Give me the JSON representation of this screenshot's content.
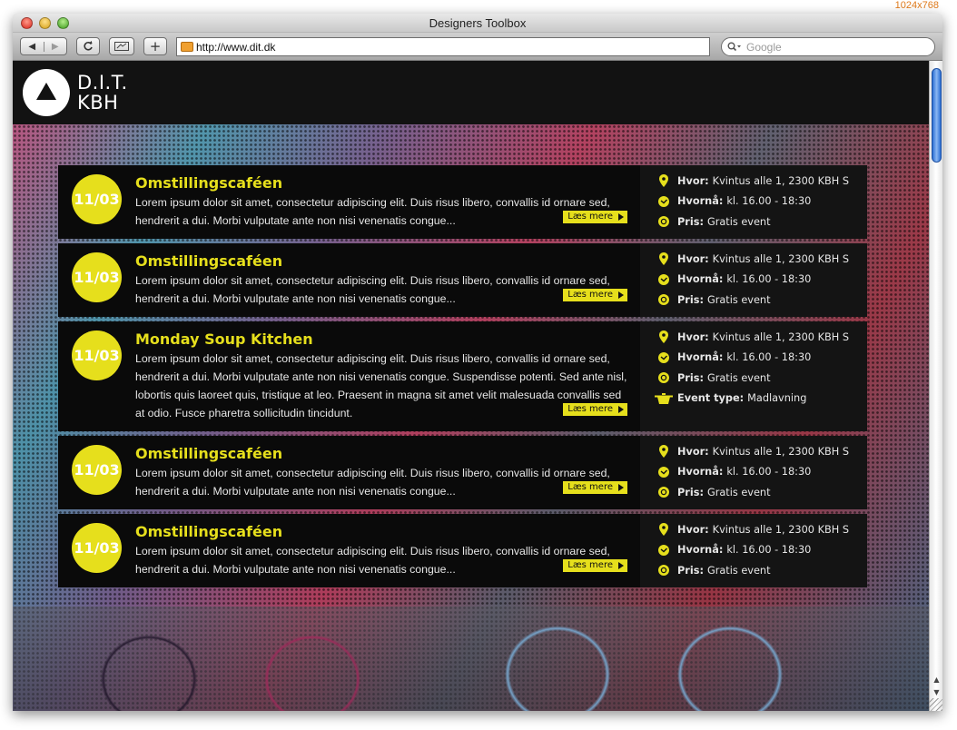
{
  "screen_size_label": "1024x768",
  "browser": {
    "title": "Designers Toolbox",
    "url": "http://www.dit.dk",
    "search_placeholder": "Google",
    "add_label": "+"
  },
  "site": {
    "logo_line1": "D.I.T.",
    "logo_line2": "KBH"
  },
  "labels": {
    "where": "Hvor:",
    "when": "Hvornå:",
    "price": "Pris:",
    "event_type": "Event type:",
    "read_more": "Læs mere"
  },
  "colors": {
    "accent": "#e6df1c",
    "panel": "#0e0e0e",
    "text": "#e6e6e6"
  },
  "events": [
    {
      "date": "11/03",
      "title": "Omstillingscaféen",
      "description": "Lorem ipsum dolor sit amet, consectetur adipiscing elit. Duis risus libero, convallis id ornare sed, hendrerit a dui. Morbi vulputate ante non nisi venenatis congue...",
      "where": "Kvintus alle 1, 2300 KBH S",
      "when": "kl. 16.00 - 18:30",
      "price": "Gratis event"
    },
    {
      "date": "11/03",
      "title": "Omstillingscaféen",
      "description": "Lorem ipsum dolor sit amet, consectetur adipiscing elit. Duis risus libero, convallis id ornare sed, hendrerit a dui. Morbi vulputate ante non nisi venenatis congue...",
      "where": "Kvintus alle 1, 2300 KBH S",
      "when": "kl. 16.00 - 18:30",
      "price": "Gratis event"
    },
    {
      "date": "11/03",
      "title": "Monday Soup Kitchen",
      "description": "Lorem ipsum dolor sit amet, consectetur adipiscing elit. Duis risus libero, convallis id ornare sed, hendrerit a dui. Morbi vulputate ante non nisi venenatis congue. Suspendisse potenti. Sed ante nisl, lobortis quis laoreet quis, tristique at leo. Praesent in magna sit amet velit malesuada convallis sed at odio. Fusce pharetra sollicitudin tincidunt.",
      "where": "Kvintus alle 1, 2300 KBH S",
      "when": "kl. 16.00 - 18:30",
      "price": "Gratis event",
      "event_type": "Madlavning"
    },
    {
      "date": "11/03",
      "title": "Omstillingscaféen",
      "description": "Lorem ipsum dolor sit amet, consectetur adipiscing elit. Duis risus libero, convallis id ornare sed, hendrerit a dui. Morbi vulputate ante non nisi venenatis congue...",
      "where": "Kvintus alle 1, 2300 KBH S",
      "when": "kl. 16.00 - 18:30",
      "price": "Gratis event"
    },
    {
      "date": "11/03",
      "title": "Omstillingscaféen",
      "description": "Lorem ipsum dolor sit amet, consectetur adipiscing elit. Duis risus libero, convallis id ornare sed, hendrerit a dui. Morbi vulputate ante non nisi venenatis congue...",
      "where": "Kvintus alle 1, 2300 KBH S",
      "when": "kl. 16.00 - 18:30",
      "price": "Gratis event"
    }
  ]
}
